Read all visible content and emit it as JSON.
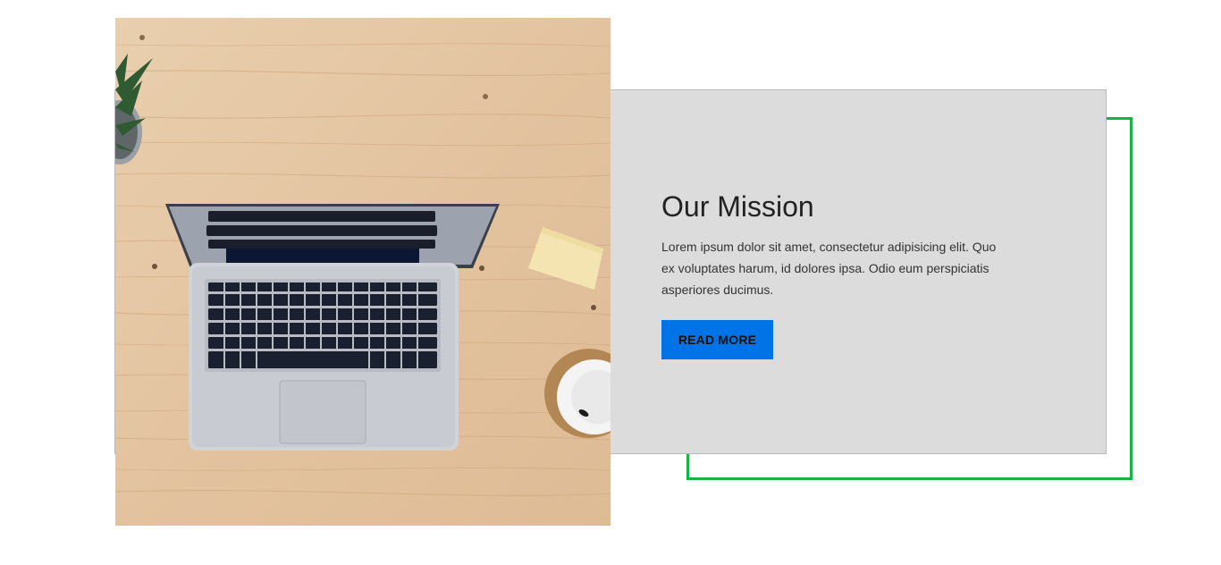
{
  "mission": {
    "title": "Our Mission",
    "body": "Lorem ipsum dolor sit amet, consectetur adipisicing elit. Quo ex voluptates harum, id dolores ipsa. Odio eum perspiciatis asperiores ducimus.",
    "button_label": "READ MORE"
  },
  "colors": {
    "accent_button": "#0073e6",
    "frame_outline": "#1db044",
    "panel_background": "#dcdcdc"
  },
  "image": {
    "subject": "laptop-on-wooden-desk-photo"
  }
}
